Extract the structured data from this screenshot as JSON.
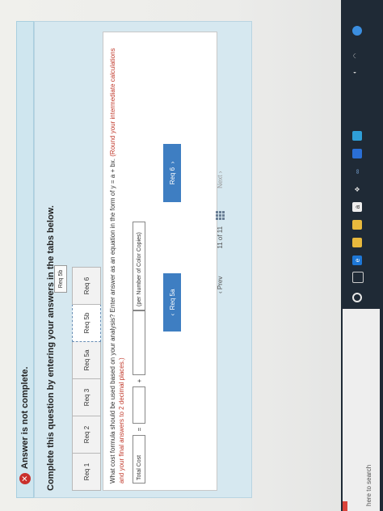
{
  "banner": {
    "icon": "error-x-icon",
    "text": "Answer is not complete."
  },
  "instructions": "Complete this question by entering your answers in the tabs below.",
  "tabs": [
    {
      "label": "Req 1"
    },
    {
      "label": "Req 2"
    },
    {
      "label": "Req 3"
    },
    {
      "label": "Req 5a"
    },
    {
      "label": "Req 5b"
    },
    {
      "label": "Req 6"
    }
  ],
  "tooltip": "Req 5b",
  "question": {
    "text": "What cost formula should be used based on your analysis? Enter answer as an equation in the form of y = a + bx.",
    "round_note": "(Round your intermediate calculations and your final answers to 2 decimal places.)"
  },
  "formula": {
    "label": "Total Cost",
    "equals": "=",
    "plus": "+",
    "unit_label": "(per Number of Color Copies)"
  },
  "nav_buttons": {
    "prev": "Req 5a",
    "next": "Req 6"
  },
  "pager": {
    "prev": "Prev",
    "position": "11 of 11",
    "next": "Next"
  },
  "taskbar": {
    "search_placeholder": "here to search"
  },
  "colors": {
    "banner_bg": "#cfe6ef",
    "panel_bg": "#d6e8f0",
    "nav_button": "#3e7ec2",
    "error": "#c9302c"
  }
}
